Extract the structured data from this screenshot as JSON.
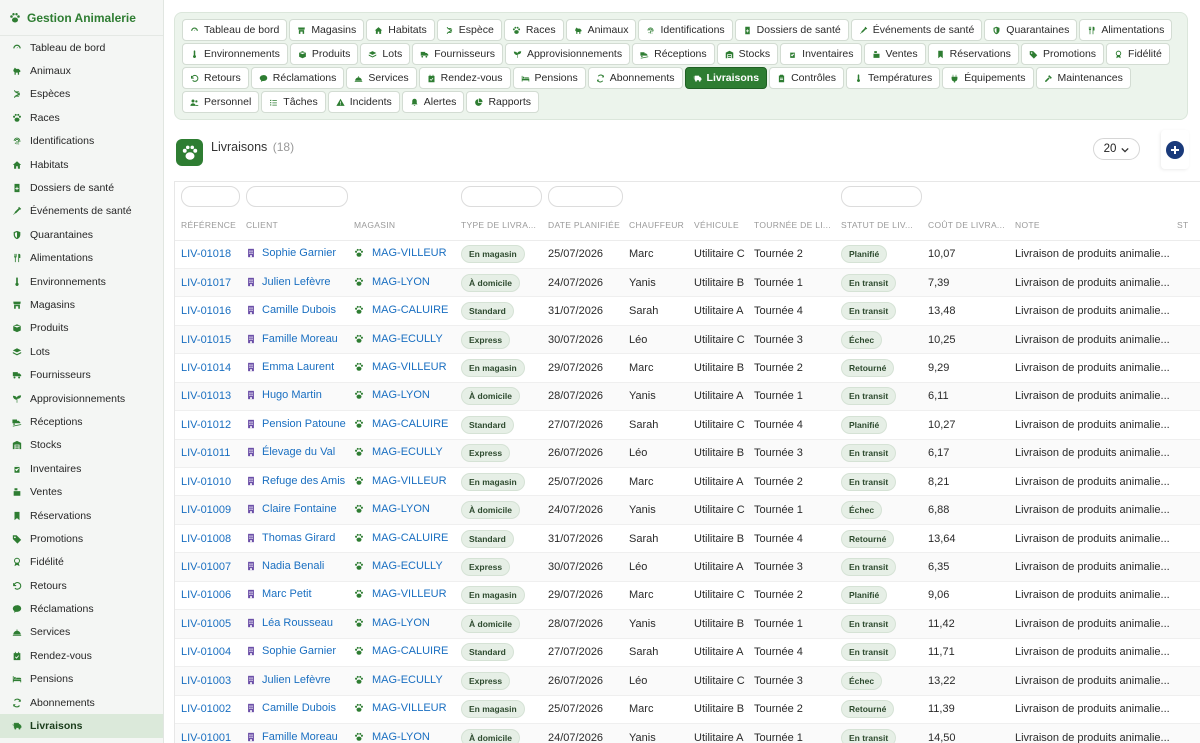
{
  "app": {
    "title": "Gestion Animalerie"
  },
  "sidebar": {
    "items": [
      {
        "label": "Tableau de bord",
        "icon": "dashboard-icon"
      },
      {
        "label": "Animaux",
        "icon": "dog-icon"
      },
      {
        "label": "Espèces",
        "icon": "dna-icon"
      },
      {
        "label": "Races",
        "icon": "paw-icon"
      },
      {
        "label": "Identifications",
        "icon": "fingerprint-icon"
      },
      {
        "label": "Habitats",
        "icon": "house-icon"
      },
      {
        "label": "Dossiers de santé",
        "icon": "medical-file-icon"
      },
      {
        "label": "Événements de santé",
        "icon": "syringe-icon"
      },
      {
        "label": "Quarantaines",
        "icon": "shield-icon"
      },
      {
        "label": "Alimentations",
        "icon": "utensils-icon"
      },
      {
        "label": "Environnements",
        "icon": "thermometer-icon"
      },
      {
        "label": "Magasins",
        "icon": "store-icon"
      },
      {
        "label": "Produits",
        "icon": "box-icon"
      },
      {
        "label": "Lots",
        "icon": "layers-icon"
      },
      {
        "label": "Fournisseurs",
        "icon": "truck-icon"
      },
      {
        "label": "Approvisionnements",
        "icon": "seedling-icon"
      },
      {
        "label": "Réceptions",
        "icon": "truck-ramp-icon"
      },
      {
        "label": "Stocks",
        "icon": "warehouse-icon"
      },
      {
        "label": "Inventaires",
        "icon": "clipboard-check-icon"
      },
      {
        "label": "Ventes",
        "icon": "cash-register-icon"
      },
      {
        "label": "Réservations",
        "icon": "bookmark-icon"
      },
      {
        "label": "Promotions",
        "icon": "tag-icon"
      },
      {
        "label": "Fidélité",
        "icon": "award-icon"
      },
      {
        "label": "Retours",
        "icon": "undo-icon"
      },
      {
        "label": "Réclamations",
        "icon": "comment-icon"
      },
      {
        "label": "Services",
        "icon": "bell-concierge-icon"
      },
      {
        "label": "Rendez-vous",
        "icon": "calendar-check-icon"
      },
      {
        "label": "Pensions",
        "icon": "bed-icon"
      },
      {
        "label": "Abonnements",
        "icon": "sync-icon"
      },
      {
        "label": "Livraisons",
        "icon": "truck-fast-icon"
      }
    ],
    "active_index": 29
  },
  "nav": {
    "pills": [
      {
        "label": "Tableau de bord",
        "icon": "dashboard-icon"
      },
      {
        "label": "Magasins",
        "icon": "store-icon"
      },
      {
        "label": "Habitats",
        "icon": "house-icon"
      },
      {
        "label": "Espèce",
        "icon": "dna-icon"
      },
      {
        "label": "Races",
        "icon": "paw-icon"
      },
      {
        "label": "Animaux",
        "icon": "dog-icon"
      },
      {
        "label": "Identifications",
        "icon": "fingerprint-icon"
      },
      {
        "label": "Dossiers de santé",
        "icon": "medical-file-icon"
      },
      {
        "label": "Événements de santé",
        "icon": "syringe-icon"
      },
      {
        "label": "Quarantaines",
        "icon": "shield-icon"
      },
      {
        "label": "Alimentations",
        "icon": "utensils-icon"
      },
      {
        "label": "Environnements",
        "icon": "thermometer-icon"
      },
      {
        "label": "Produits",
        "icon": "box-icon"
      },
      {
        "label": "Lots",
        "icon": "layers-icon"
      },
      {
        "label": "Fournisseurs",
        "icon": "truck-icon"
      },
      {
        "label": "Approvisionnements",
        "icon": "seedling-icon"
      },
      {
        "label": "Réceptions",
        "icon": "truck-ramp-icon"
      },
      {
        "label": "Stocks",
        "icon": "warehouse-icon"
      },
      {
        "label": "Inventaires",
        "icon": "clipboard-check-icon"
      },
      {
        "label": "Ventes",
        "icon": "cash-register-icon"
      },
      {
        "label": "Réservations",
        "icon": "bookmark-icon"
      },
      {
        "label": "Promotions",
        "icon": "tag-icon"
      },
      {
        "label": "Fidélité",
        "icon": "award-icon"
      },
      {
        "label": "Retours",
        "icon": "undo-icon"
      },
      {
        "label": "Réclamations",
        "icon": "comment-icon"
      },
      {
        "label": "Services",
        "icon": "bell-concierge-icon"
      },
      {
        "label": "Rendez-vous",
        "icon": "calendar-check-icon"
      },
      {
        "label": "Pensions",
        "icon": "bed-icon"
      },
      {
        "label": "Abonnements",
        "icon": "sync-icon"
      },
      {
        "label": "Livraisons",
        "icon": "truck-fast-icon"
      },
      {
        "label": "Contrôles",
        "icon": "clipboard-icon"
      },
      {
        "label": "Températures",
        "icon": "thermometer-icon"
      },
      {
        "label": "Équipements",
        "icon": "plug-icon"
      },
      {
        "label": "Maintenances",
        "icon": "tools-icon"
      },
      {
        "label": "Personnel",
        "icon": "users-icon"
      },
      {
        "label": "Tâches",
        "icon": "list-icon"
      },
      {
        "label": "Incidents",
        "icon": "warning-icon"
      },
      {
        "label": "Alertes",
        "icon": "bell-icon"
      },
      {
        "label": "Rapports",
        "icon": "chart-pie-icon"
      }
    ],
    "active_index": 29
  },
  "page": {
    "title": "Livraisons",
    "count": "(18)",
    "page_size": "20"
  },
  "table": {
    "columns": [
      "RÉFÉRENCE",
      "CLIENT",
      "MAGASIN",
      "TYPE DE LIVRA...",
      "DATE PLANIFIÉE",
      "CHAUFFEUR",
      "VÉHICULE",
      "TOURNÉE DE LI...",
      "STATUT DE LIV...",
      "COÛT DE LIVRA...",
      "NOTE",
      "ST"
    ],
    "filter_columns": [
      0,
      1,
      3,
      4,
      8
    ],
    "rows": [
      {
        "ref": "LIV-01018",
        "client": "Sophie Garnier",
        "magasin": "MAG-VILLEUR",
        "type": "En magasin",
        "date": "25/07/2026",
        "chauffeur": "Marc",
        "vehicule": "Utilitaire C",
        "tournee": "Tournée 2",
        "statut": "Planifié",
        "cout": "10,07",
        "note": "Livraison de produits animalie..."
      },
      {
        "ref": "LIV-01017",
        "client": "Julien Lefèvre",
        "magasin": "MAG-LYON",
        "type": "À domicile",
        "date": "24/07/2026",
        "chauffeur": "Yanis",
        "vehicule": "Utilitaire B",
        "tournee": "Tournée 1",
        "statut": "En transit",
        "cout": "7,39",
        "note": "Livraison de produits animalie..."
      },
      {
        "ref": "LIV-01016",
        "client": "Camille Dubois",
        "magasin": "MAG-CALUIRE",
        "type": "Standard",
        "date": "31/07/2026",
        "chauffeur": "Sarah",
        "vehicule": "Utilitaire A",
        "tournee": "Tournée 4",
        "statut": "En transit",
        "cout": "13,48",
        "note": "Livraison de produits animalie..."
      },
      {
        "ref": "LIV-01015",
        "client": "Famille Moreau",
        "magasin": "MAG-ECULLY",
        "type": "Express",
        "date": "30/07/2026",
        "chauffeur": "Léo",
        "vehicule": "Utilitaire C",
        "tournee": "Tournée 3",
        "statut": "Échec",
        "cout": "10,25",
        "note": "Livraison de produits animalie..."
      },
      {
        "ref": "LIV-01014",
        "client": "Emma Laurent",
        "magasin": "MAG-VILLEUR",
        "type": "En magasin",
        "date": "29/07/2026",
        "chauffeur": "Marc",
        "vehicule": "Utilitaire B",
        "tournee": "Tournée 2",
        "statut": "Retourné",
        "cout": "9,29",
        "note": "Livraison de produits animalie..."
      },
      {
        "ref": "LIV-01013",
        "client": "Hugo Martin",
        "magasin": "MAG-LYON",
        "type": "À domicile",
        "date": "28/07/2026",
        "chauffeur": "Yanis",
        "vehicule": "Utilitaire A",
        "tournee": "Tournée 1",
        "statut": "En transit",
        "cout": "6,11",
        "note": "Livraison de produits animalie..."
      },
      {
        "ref": "LIV-01012",
        "client": "Pension Patoune",
        "magasin": "MAG-CALUIRE",
        "type": "Standard",
        "date": "27/07/2026",
        "chauffeur": "Sarah",
        "vehicule": "Utilitaire C",
        "tournee": "Tournée 4",
        "statut": "Planifié",
        "cout": "10,27",
        "note": "Livraison de produits animalie..."
      },
      {
        "ref": "LIV-01011",
        "client": "Élevage du Val",
        "magasin": "MAG-ECULLY",
        "type": "Express",
        "date": "26/07/2026",
        "chauffeur": "Léo",
        "vehicule": "Utilitaire B",
        "tournee": "Tournée 3",
        "statut": "En transit",
        "cout": "6,17",
        "note": "Livraison de produits animalie..."
      },
      {
        "ref": "LIV-01010",
        "client": "Refuge des Amis",
        "magasin": "MAG-VILLEUR",
        "type": "En magasin",
        "date": "25/07/2026",
        "chauffeur": "Marc",
        "vehicule": "Utilitaire A",
        "tournee": "Tournée 2",
        "statut": "En transit",
        "cout": "8,21",
        "note": "Livraison de produits animalie..."
      },
      {
        "ref": "LIV-01009",
        "client": "Claire Fontaine",
        "magasin": "MAG-LYON",
        "type": "À domicile",
        "date": "24/07/2026",
        "chauffeur": "Yanis",
        "vehicule": "Utilitaire C",
        "tournee": "Tournée 1",
        "statut": "Échec",
        "cout": "6,88",
        "note": "Livraison de produits animalie..."
      },
      {
        "ref": "LIV-01008",
        "client": "Thomas Girard",
        "magasin": "MAG-CALUIRE",
        "type": "Standard",
        "date": "31/07/2026",
        "chauffeur": "Sarah",
        "vehicule": "Utilitaire B",
        "tournee": "Tournée 4",
        "statut": "Retourné",
        "cout": "13,64",
        "note": "Livraison de produits animalie..."
      },
      {
        "ref": "LIV-01007",
        "client": "Nadia Benali",
        "magasin": "MAG-ECULLY",
        "type": "Express",
        "date": "30/07/2026",
        "chauffeur": "Léo",
        "vehicule": "Utilitaire A",
        "tournee": "Tournée 3",
        "statut": "En transit",
        "cout": "6,35",
        "note": "Livraison de produits animalie..."
      },
      {
        "ref": "LIV-01006",
        "client": "Marc Petit",
        "magasin": "MAG-VILLEUR",
        "type": "En magasin",
        "date": "29/07/2026",
        "chauffeur": "Marc",
        "vehicule": "Utilitaire C",
        "tournee": "Tournée 2",
        "statut": "Planifié",
        "cout": "9,06",
        "note": "Livraison de produits animalie..."
      },
      {
        "ref": "LIV-01005",
        "client": "Léa Rousseau",
        "magasin": "MAG-LYON",
        "type": "À domicile",
        "date": "28/07/2026",
        "chauffeur": "Yanis",
        "vehicule": "Utilitaire B",
        "tournee": "Tournée 1",
        "statut": "En transit",
        "cout": "11,42",
        "note": "Livraison de produits animalie..."
      },
      {
        "ref": "LIV-01004",
        "client": "Sophie Garnier",
        "magasin": "MAG-CALUIRE",
        "type": "Standard",
        "date": "27/07/2026",
        "chauffeur": "Sarah",
        "vehicule": "Utilitaire A",
        "tournee": "Tournée 4",
        "statut": "En transit",
        "cout": "11,71",
        "note": "Livraison de produits animalie..."
      },
      {
        "ref": "LIV-01003",
        "client": "Julien Lefèvre",
        "magasin": "MAG-ECULLY",
        "type": "Express",
        "date": "26/07/2026",
        "chauffeur": "Léo",
        "vehicule": "Utilitaire C",
        "tournee": "Tournée 3",
        "statut": "Échec",
        "cout": "13,22",
        "note": "Livraison de produits animalie..."
      },
      {
        "ref": "LIV-01002",
        "client": "Camille Dubois",
        "magasin": "MAG-VILLEUR",
        "type": "En magasin",
        "date": "25/07/2026",
        "chauffeur": "Marc",
        "vehicule": "Utilitaire B",
        "tournee": "Tournée 2",
        "statut": "Retourné",
        "cout": "11,39",
        "note": "Livraison de produits animalie..."
      },
      {
        "ref": "LIV-01001",
        "client": "Famille Moreau",
        "magasin": "MAG-LYON",
        "type": "À domicile",
        "date": "24/07/2026",
        "chauffeur": "Yanis",
        "vehicule": "Utilitaire A",
        "tournee": "Tournée 1",
        "statut": "En transit",
        "cout": "14,50",
        "note": "Livraison de produits animalie..."
      }
    ]
  },
  "colors": {
    "brand": "#2e7d32",
    "link": "#1a6fc1",
    "cost": "#207a6c",
    "add_button": "#1a3a7a"
  }
}
